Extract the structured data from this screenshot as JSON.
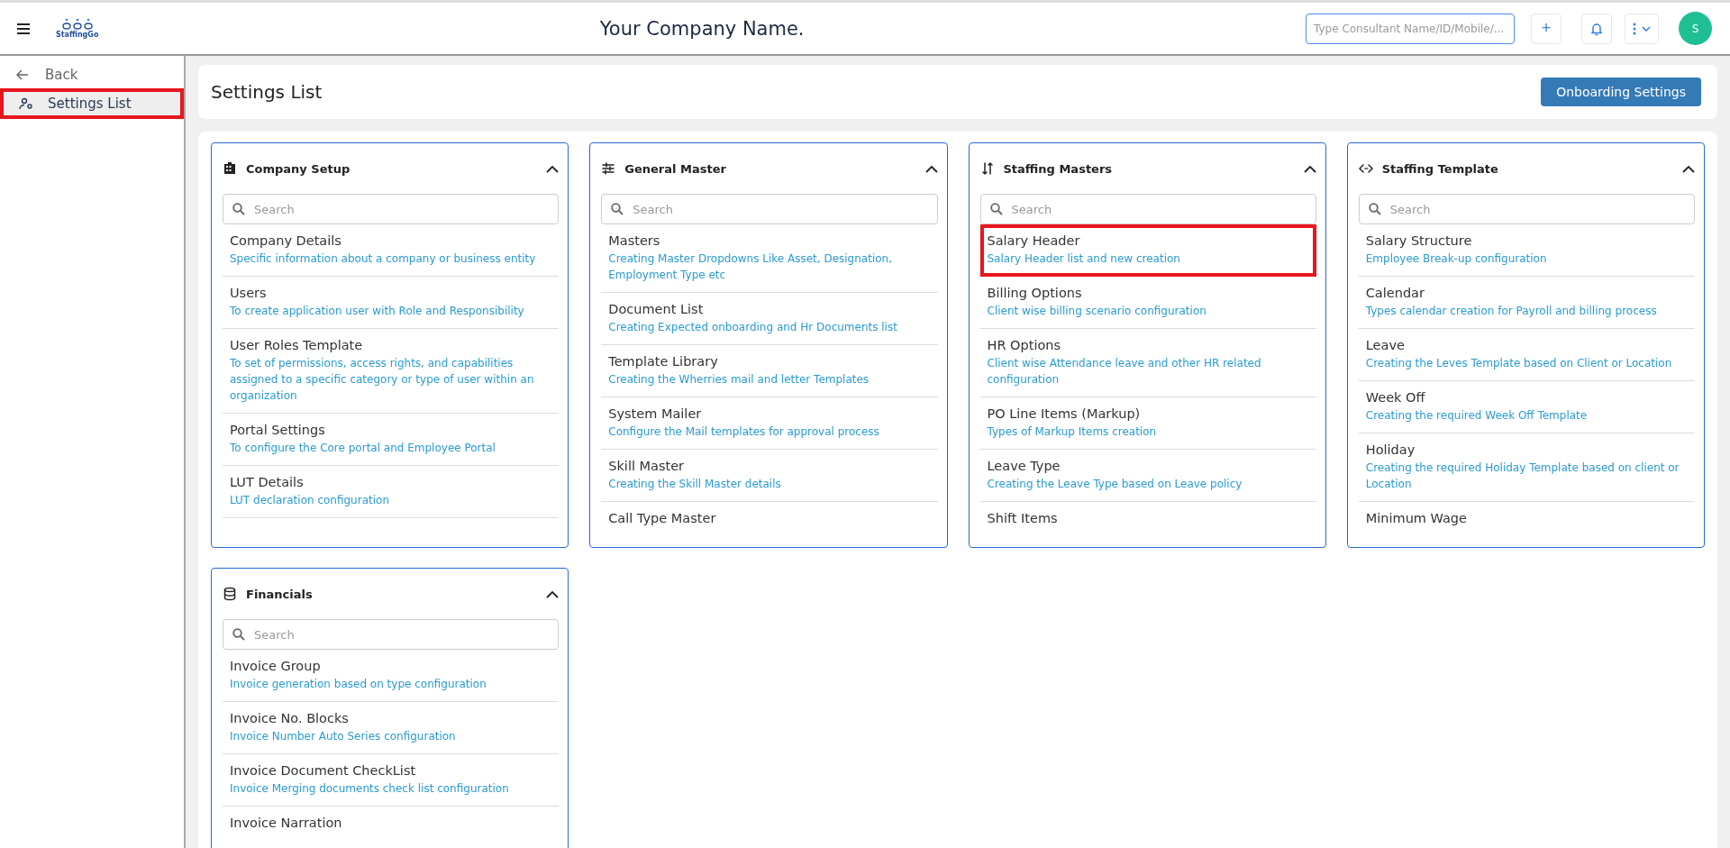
{
  "header": {
    "logo": "StaffingGo",
    "company": "Your Company Name.",
    "search": {
      "placeholder": "Type Consultant Name/ID/Mobile/..."
    },
    "add_button": "+",
    "avatar": "S"
  },
  "sidebar": {
    "back": "Back",
    "items": [
      {
        "label": "Settings List",
        "selected": true,
        "highlighted": true
      }
    ]
  },
  "page": {
    "title": "Settings List",
    "button": "Onboarding Settings"
  },
  "cards": [
    {
      "kind": "building",
      "title": "Company Setup",
      "expanded": true,
      "search_placeholder": "Search",
      "items": [
        {
          "title": "Company Details",
          "description": "Specific information about a company or business entity",
          "highlighted": false
        },
        {
          "title": "Users",
          "description": "To create application user with Role and Responsibility",
          "highlighted": false
        },
        {
          "title": "User Roles Template",
          "description": "To set of permissions, access rights, and capabilities assigned to a specific category or type of user within an organization",
          "highlighted": false
        },
        {
          "title": "Portal Settings",
          "description": "To configure the Core portal and Employee Portal",
          "highlighted": false
        },
        {
          "title": "LUT Details",
          "description": "LUT declaration configuration",
          "highlighted": false
        }
      ]
    },
    {
      "kind": "sliders",
      "title": "General Master",
      "expanded": true,
      "search_placeholder": "Search",
      "items": [
        {
          "title": "Masters",
          "description": "Creating Master Dropdowns Like Asset, Designation, Employment Type etc",
          "highlighted": false
        },
        {
          "title": "Document List",
          "description": "Creating Expected onboarding and Hr Documents list",
          "highlighted": false
        },
        {
          "title": "Template Library",
          "description": "Creating the Wherries mail and letter Templates",
          "highlighted": false
        },
        {
          "title": "System Mailer",
          "description": "Configure the Mail templates for approval process",
          "highlighted": false
        },
        {
          "title": "Skill Master",
          "description": "Creating the Skill Master details",
          "highlighted": false
        },
        {
          "title": "Call Type Master",
          "highlighted": false
        }
      ]
    },
    {
      "kind": "sort",
      "title": "Staffing Masters",
      "expanded": true,
      "search_placeholder": "Search",
      "items": [
        {
          "title": "Salary Header",
          "description": "Salary Header list and new creation",
          "highlighted": true
        },
        {
          "title": "Billing Options",
          "description": "Client wise billing scenario configuration",
          "highlighted": false
        },
        {
          "title": "HR Options",
          "description": "Client wise Attendance leave and other HR related configuration",
          "highlighted": false
        },
        {
          "title": "PO Line Items (Markup)",
          "description": "Types of Markup Items creation",
          "highlighted": false
        },
        {
          "title": "Leave Type",
          "description": "Creating the Leave Type based on Leave policy",
          "highlighted": false
        },
        {
          "title": "Shift Items",
          "highlighted": false
        }
      ]
    },
    {
      "kind": "code",
      "title": "Staffing Template",
      "expanded": true,
      "search_placeholder": "Search",
      "items": [
        {
          "title": "Salary Structure",
          "description": "Employee Break-up configuration",
          "highlighted": false
        },
        {
          "title": "Calendar",
          "description": "Types calendar creation for Payroll and billing process",
          "highlighted": false
        },
        {
          "title": "Leave",
          "description": "Creating the Leves Template based on Client or Location",
          "highlighted": false
        },
        {
          "title": "Week Off",
          "description": "Creating the required Week Off Template",
          "highlighted": false
        },
        {
          "title": "Holiday",
          "description": "Creating the required Holiday Template based on client or Location",
          "highlighted": false
        },
        {
          "title": "Minimum Wage",
          "highlighted": false
        }
      ]
    },
    {
      "kind": "database",
      "title": "Financials",
      "expanded": true,
      "search_placeholder": "Search",
      "items": [
        {
          "title": "Invoice Group",
          "description": "Invoice generation based on type configuration",
          "highlighted": false
        },
        {
          "title": "Invoice No. Blocks",
          "description": "Invoice Number Auto Series configuration",
          "highlighted": false
        },
        {
          "title": "Invoice Document CheckList",
          "description": "Invoice Merging documents check list configuration",
          "highlighted": false
        },
        {
          "title": "Invoice Narration",
          "highlighted": false
        }
      ]
    }
  ]
}
